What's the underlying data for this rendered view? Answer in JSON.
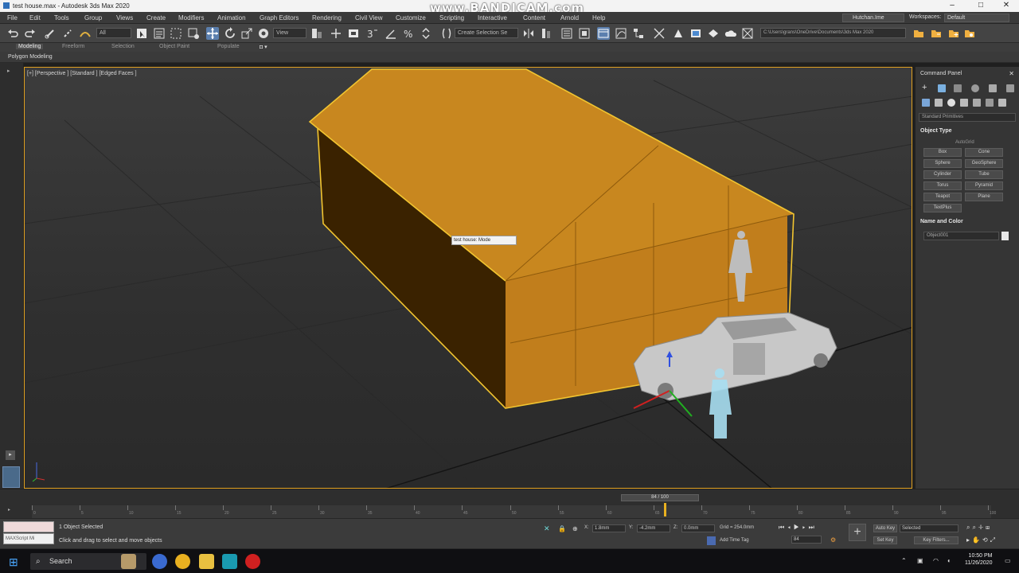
{
  "window": {
    "title": "test house.max - Autodesk 3ds Max 2020",
    "watermark": "www.BANDICAM.com",
    "minimize": "–",
    "maximize": "□",
    "close": "✕"
  },
  "menu": {
    "items": [
      "File",
      "Edit",
      "Tools",
      "Group",
      "Views",
      "Create",
      "Modifiers",
      "Animation",
      "Graph Editors",
      "Rendering",
      "Civil View",
      "Customize",
      "Scripting",
      "Interactive",
      "Content",
      "Arnold",
      "Help"
    ],
    "account": "Hutchan.Ime",
    "workspaces_label": "Workspaces:",
    "workspace": "Default"
  },
  "toolbar": {
    "filter_select": "All",
    "view_select": "View",
    "selection_set": "Create Selection Se",
    "project_path": "C:\\Users\\grans\\OneDrive\\Documents\\3ds Max 2020"
  },
  "ribbon": {
    "tabs": [
      "Modeling",
      "Freeform",
      "Selection",
      "Object Paint",
      "Populate"
    ],
    "sub_label": "Polygon Modeling"
  },
  "viewport": {
    "label": "[+] [Perspective ] [Standard ] [Edged Faces ]",
    "tooltip": "test house: Mode"
  },
  "command_panel": {
    "title": "Command Panel",
    "category": "Standard Primitives",
    "object_type_title": "Object Type",
    "autogrid": "AutoGrid",
    "buttons": [
      "Box",
      "Cone",
      "Sphere",
      "GeoSphere",
      "Cylinder",
      "Tube",
      "Torus",
      "Pyramid",
      "Teapot",
      "Plane",
      "TextPlus"
    ],
    "name_color_title": "Name and Color",
    "object_name": "Object001"
  },
  "timeline": {
    "frame_slider": "84 / 100",
    "ticks": [
      "0",
      "5",
      "10",
      "15",
      "20",
      "25",
      "30",
      "35",
      "40",
      "45",
      "50",
      "55",
      "60",
      "65",
      "70",
      "75",
      "80",
      "85",
      "90",
      "95",
      "100"
    ]
  },
  "status": {
    "maxscript": "MAXScript Mi",
    "selected": "1 Object Selected",
    "prompt": "Click and drag to select and move objects",
    "x_label": "X:",
    "x": "1.8mm",
    "y_label": "Y:",
    "y": "-4.2mm",
    "z_label": "Z:",
    "z": "0.0mm",
    "grid": "Grid = 254.0mm",
    "add_time_tag": "Add Time Tag",
    "frame": "84",
    "auto_key": "Auto Key",
    "set_key": "Set Key",
    "key_mode": "Selected",
    "key_filters": "Key Filters..."
  },
  "taskbar": {
    "search": "Search",
    "time": "10:50 PM",
    "date": "11/26/2020"
  }
}
